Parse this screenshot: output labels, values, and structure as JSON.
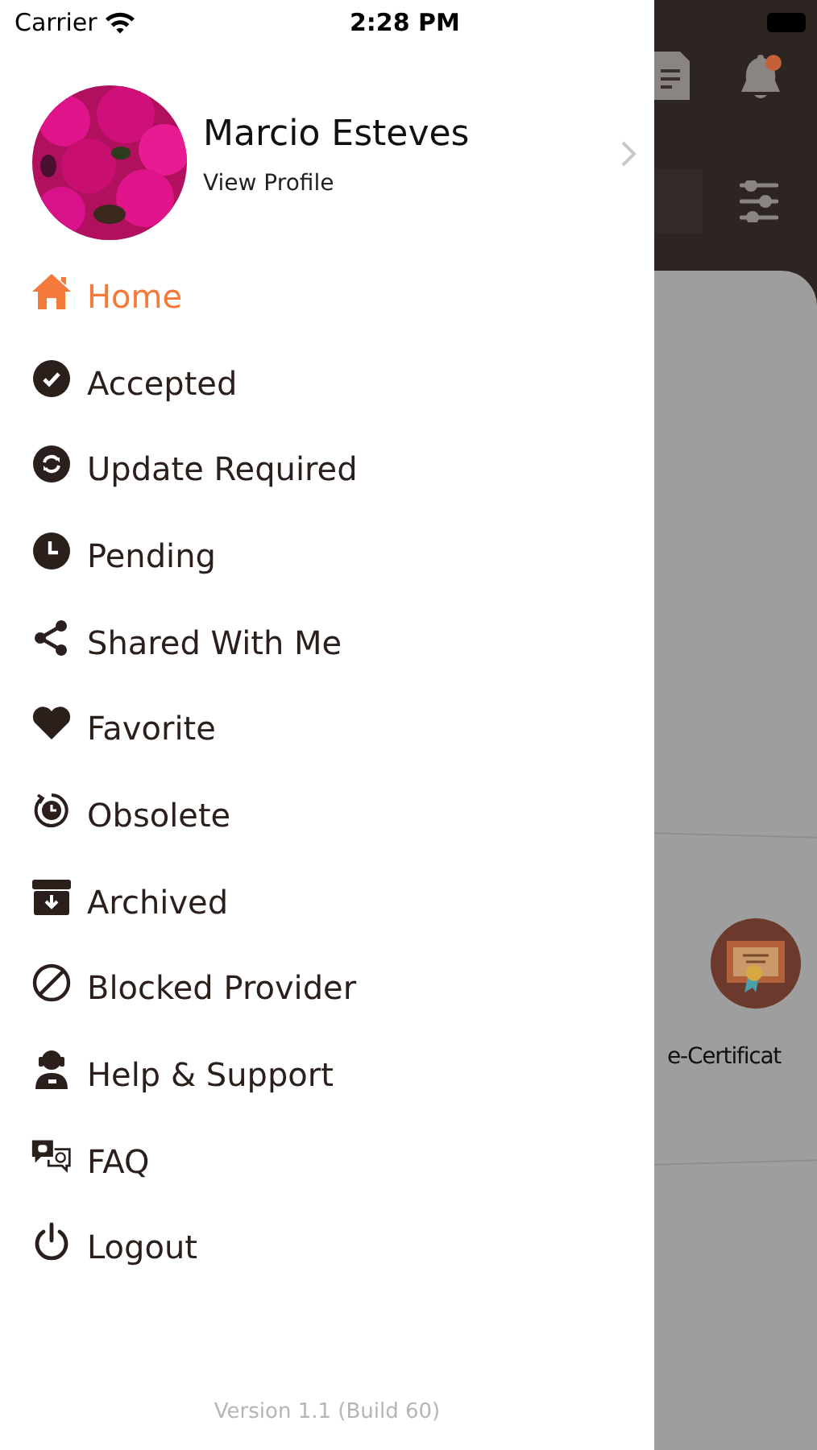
{
  "status_bar": {
    "carrier": "Carrier",
    "time": "2:28 PM"
  },
  "profile": {
    "name": "Marcio Esteves",
    "link": "View Profile"
  },
  "menu": [
    {
      "kind": "home",
      "label": "Home",
      "selected": true
    },
    {
      "kind": "accepted",
      "label": "Accepted",
      "selected": false
    },
    {
      "kind": "update",
      "label": "Update Required",
      "selected": false
    },
    {
      "kind": "pending",
      "label": "Pending",
      "selected": false
    },
    {
      "kind": "shared",
      "label": "Shared With Me",
      "selected": false
    },
    {
      "kind": "favorite",
      "label": "Favorite",
      "selected": false
    },
    {
      "kind": "obsolete",
      "label": "Obsolete",
      "selected": false
    },
    {
      "kind": "archived",
      "label": "Archived",
      "selected": false
    },
    {
      "kind": "blocked",
      "label": "Blocked Provider",
      "selected": false
    },
    {
      "kind": "help",
      "label": "Help & Support",
      "selected": false
    },
    {
      "kind": "faq",
      "label": "FAQ",
      "selected": false
    },
    {
      "kind": "logout",
      "label": "Logout",
      "selected": false
    }
  ],
  "version": "Version 1.1 (Build 60)",
  "background": {
    "card_label": "e-Certificat"
  }
}
